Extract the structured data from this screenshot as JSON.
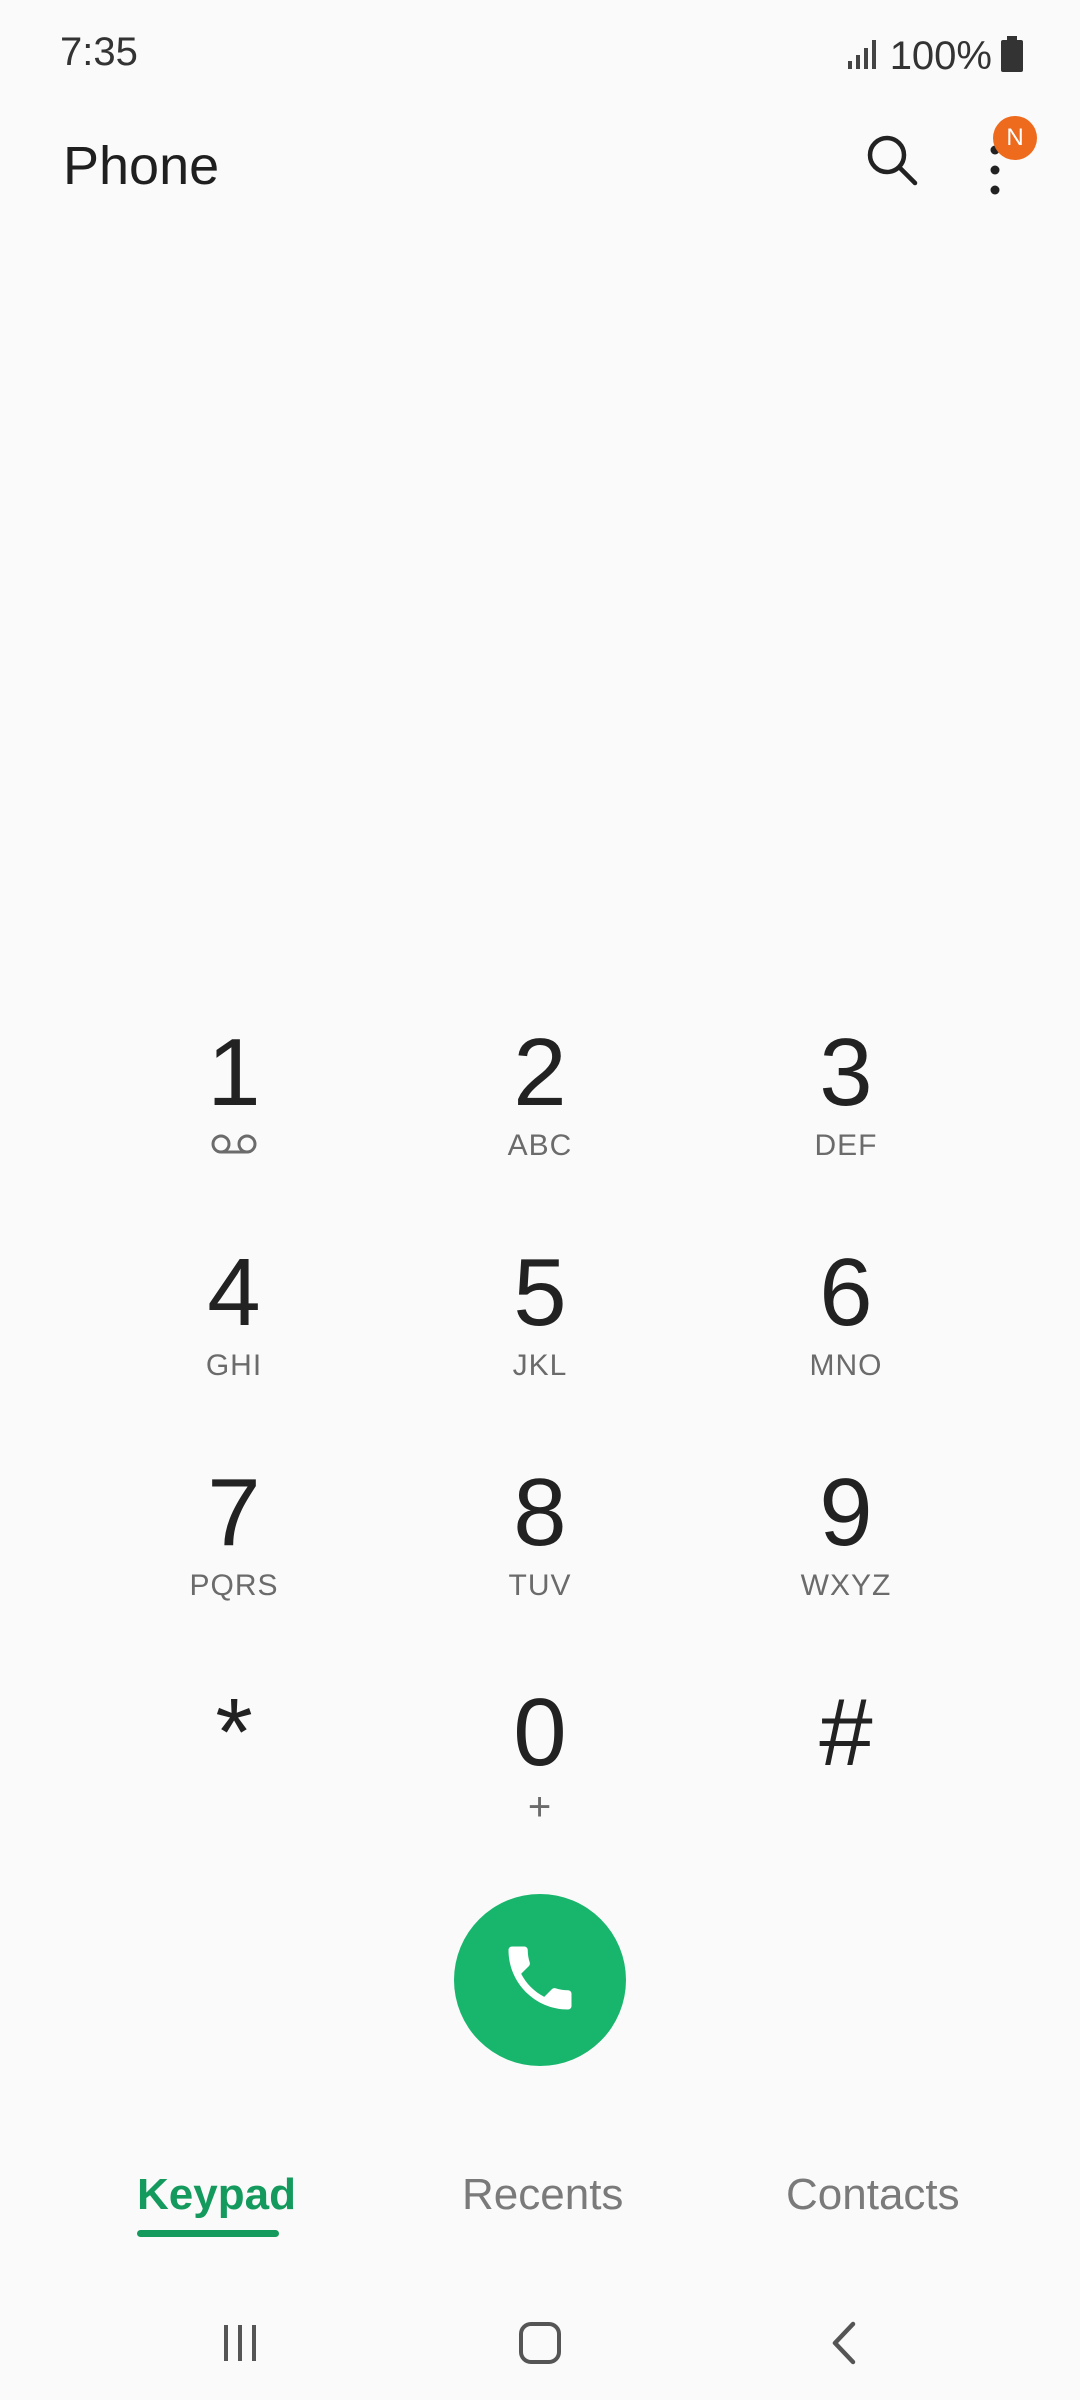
{
  "status_bar": {
    "time": "7:35",
    "battery": "100%",
    "icons": [
      "signal-icon",
      "battery-icon"
    ]
  },
  "app_bar": {
    "title": "Phone",
    "search_icon": "search-icon",
    "more_icon": "more-vert-icon",
    "badge": "N"
  },
  "keypad": {
    "keys": [
      {
        "digit": "1",
        "sub": "",
        "icon": "voicemail-icon"
      },
      {
        "digit": "2",
        "sub": "ABC"
      },
      {
        "digit": "3",
        "sub": "DEF"
      },
      {
        "digit": "4",
        "sub": "GHI"
      },
      {
        "digit": "5",
        "sub": "JKL"
      },
      {
        "digit": "6",
        "sub": "MNO"
      },
      {
        "digit": "7",
        "sub": "PQRS"
      },
      {
        "digit": "8",
        "sub": "TUV"
      },
      {
        "digit": "9",
        "sub": "WXYZ"
      },
      {
        "digit": "*",
        "sub": ""
      },
      {
        "digit": "0",
        "sub": "+"
      },
      {
        "digit": "#",
        "sub": ""
      }
    ]
  },
  "call_button": {
    "icon": "phone-icon"
  },
  "tabs": {
    "items": [
      {
        "label": "Keypad",
        "active": true
      },
      {
        "label": "Recents",
        "active": false
      },
      {
        "label": "Contacts",
        "active": false
      }
    ]
  },
  "nav_bar": {
    "icons": [
      "recents-icon",
      "home-icon",
      "back-icon"
    ]
  },
  "colors": {
    "accent": "#149a5d",
    "call": "#17b66c",
    "badge": "#ee6a1c",
    "background": "#fafafa"
  }
}
